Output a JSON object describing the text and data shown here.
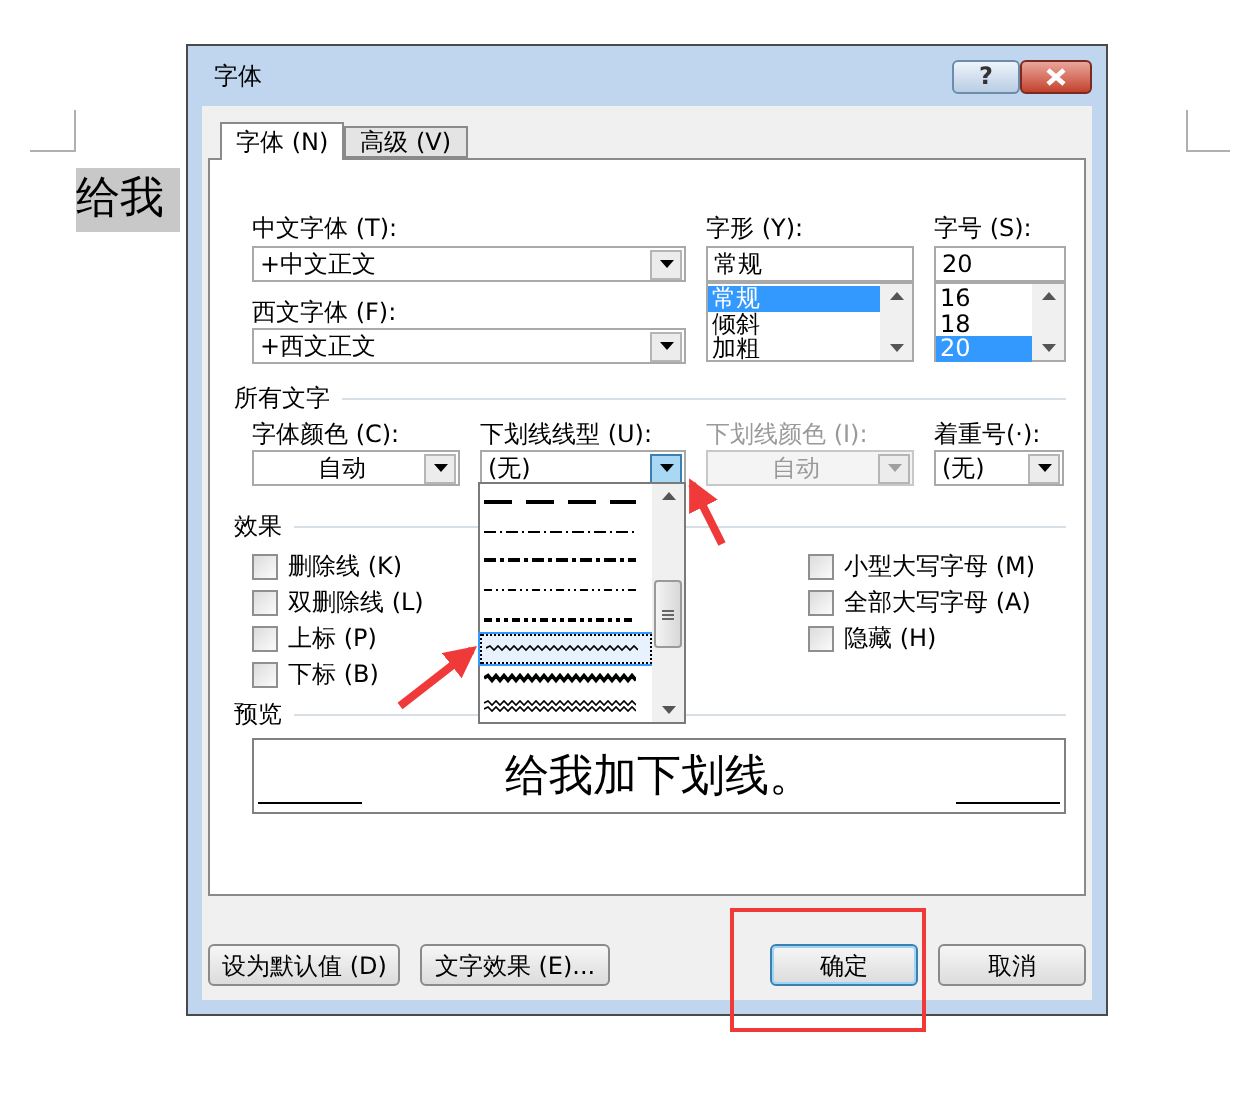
{
  "document": {
    "text": "给我"
  },
  "dialog": {
    "title": "字体",
    "help": "?"
  },
  "tabs": [
    {
      "label": "字体 (N)",
      "selected": true
    },
    {
      "label": "高级 (V)",
      "selected": false
    }
  ],
  "chinese_font": {
    "label": "中文字体 (T):",
    "value": "+中文正文"
  },
  "western_font": {
    "label": "西文字体 (F):",
    "value": "+西文正文"
  },
  "font_style": {
    "label": "字形 (Y):",
    "value": "常规",
    "options": [
      {
        "label": "常规",
        "selected": true
      },
      {
        "label": "倾斜",
        "selected": false
      },
      {
        "label": "加粗",
        "selected": false
      }
    ]
  },
  "font_size": {
    "label": "字号 (S):",
    "value": "20",
    "options": [
      {
        "label": "16",
        "selected": false
      },
      {
        "label": "18",
        "selected": false
      },
      {
        "label": "20",
        "selected": true
      }
    ]
  },
  "all_text": {
    "title": "所有文字",
    "fields": [
      {
        "label": "字体颜色 (C):",
        "value": "自动",
        "kind": "color",
        "disabled": false,
        "expanded": false
      },
      {
        "label": "下划线线型 (U):",
        "value": "(无)",
        "kind": "list",
        "disabled": false,
        "expanded": true
      },
      {
        "label": "下划线颜色 (I):",
        "value": "自动",
        "kind": "color",
        "disabled": true,
        "expanded": false
      },
      {
        "label": "着重号(·):",
        "value": "(无)",
        "kind": "list",
        "disabled": false,
        "expanded": false
      }
    ]
  },
  "underline_options": [
    {
      "kind": "dash-long",
      "selected": false
    },
    {
      "kind": "dash-dot",
      "selected": false
    },
    {
      "kind": "dash-dot-heavy",
      "selected": false
    },
    {
      "kind": "dash-dot-dot",
      "selected": false
    },
    {
      "kind": "dash-dot-dot-heavy",
      "selected": false
    },
    {
      "kind": "wave",
      "selected": true
    },
    {
      "kind": "wave-heavy",
      "selected": false
    },
    {
      "kind": "wave-double",
      "selected": false
    }
  ],
  "effects": {
    "title": "效果",
    "left": [
      {
        "label": "删除线 (K)",
        "checked": false
      },
      {
        "label": "双删除线 (L)",
        "checked": false
      },
      {
        "label": "上标 (P)",
        "checked": false
      },
      {
        "label": "下标 (B)",
        "checked": false
      }
    ],
    "right": [
      {
        "label": "小型大写字母 (M)",
        "checked": false
      },
      {
        "label": "全部大写字母 (A)",
        "checked": false
      },
      {
        "label": "隐藏 (H)",
        "checked": false
      }
    ]
  },
  "preview": {
    "title": "预览",
    "text": "给我加下划线。"
  },
  "buttons": [
    {
      "label": "设为默认值 (D)",
      "default": false
    },
    {
      "label": "文字效果 (E)...",
      "default": false
    },
    {
      "label": "确定",
      "default": true
    },
    {
      "label": "取消",
      "default": false
    }
  ]
}
